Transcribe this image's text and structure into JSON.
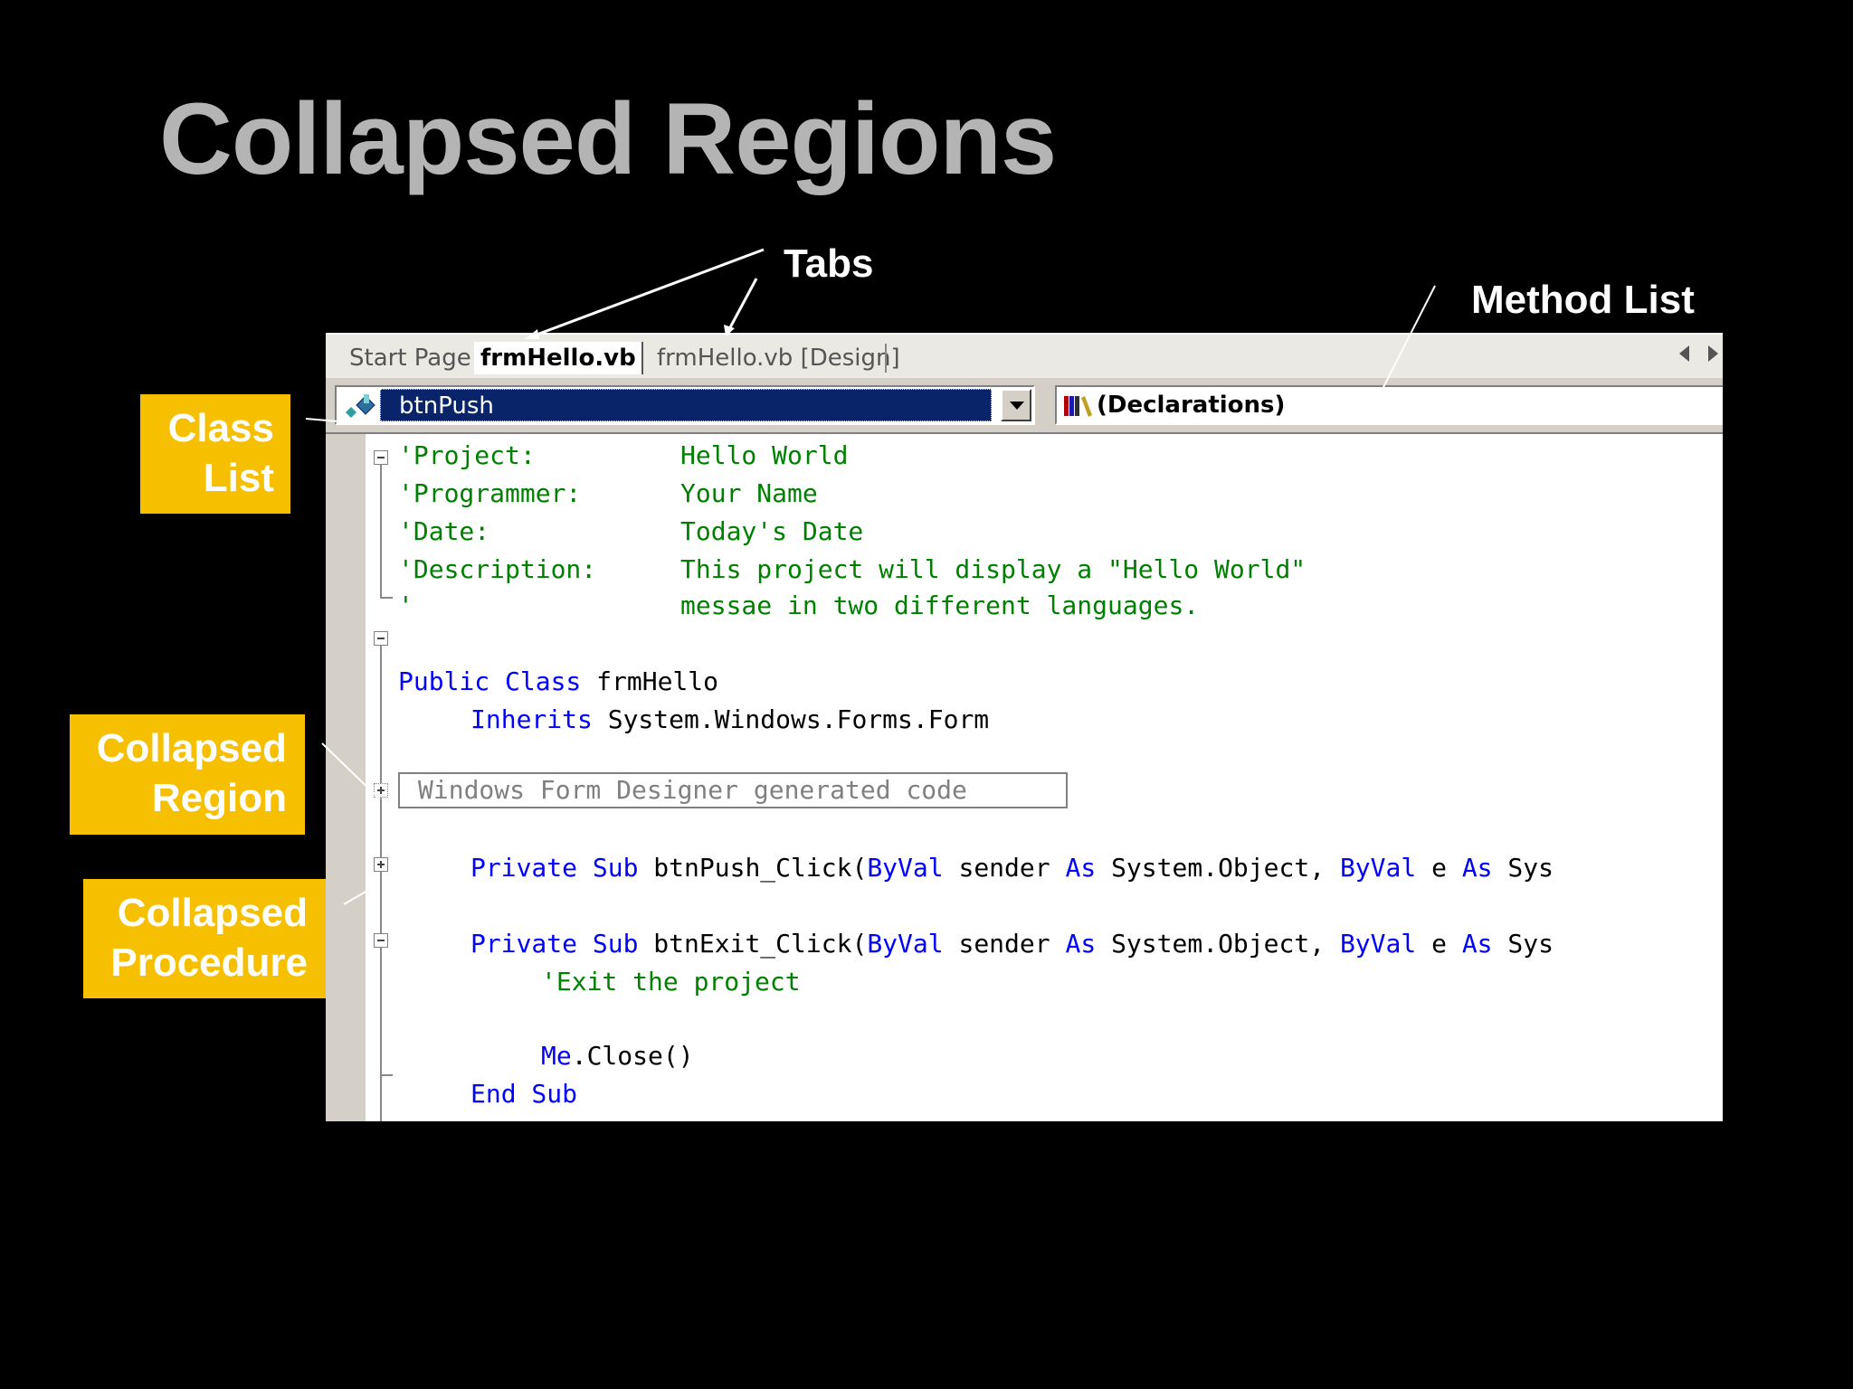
{
  "slide": {
    "title": "Collapsed Regions"
  },
  "callouts": {
    "tabs": "Tabs",
    "method_list": "Method List",
    "class_list": [
      "Class",
      "List"
    ],
    "collapsed_region": [
      "Collapsed",
      "Region"
    ],
    "collapsed_procedure": [
      "Collapsed",
      "Procedure"
    ]
  },
  "colors": {
    "callout_bg": "#f6c000",
    "title": "#b4b4b4",
    "keyword": "#0000ff",
    "comment": "#008000",
    "selection": "#0a246a"
  },
  "tabs": [
    {
      "label": "Start Page",
      "active": false
    },
    {
      "label": "frmHello.vb",
      "active": true
    },
    {
      "label": "frmHello.vb [Design]",
      "active": false
    }
  ],
  "class_list": {
    "selected": "btnPush",
    "icon": "class-member-icon"
  },
  "method_list": {
    "selected": "(Declarations)",
    "icon": "books-icon"
  },
  "code": {
    "header_comments": [
      {
        "label": "'Project:",
        "value": "Hello World"
      },
      {
        "label": "'Programmer:",
        "value": "Your Name"
      },
      {
        "label": "'Date:",
        "value": "Today's Date"
      },
      {
        "label": "'Description:",
        "value": "This project will display a \"Hello World\""
      },
      {
        "label": "'",
        "value": "messae in two different languages."
      }
    ],
    "class_decl": {
      "kw": "Public Class",
      "name": "frmHello"
    },
    "inherits": {
      "kw": "Inherits",
      "name": "System.Windows.Forms.Form"
    },
    "region_label": "Windows Form Designer generated code",
    "btn_push": {
      "kw1": "Private Sub",
      "name": "btnPush_Click(",
      "kw2": "ByVal",
      "t1": "sender",
      "kw3": "As",
      "t2": "System.Object,",
      "kw4": "ByVal",
      "t3": "e",
      "kw5": "As",
      "t4": "Sys"
    },
    "btn_exit": {
      "kw1": "Private Sub",
      "name": "btnExit_Click(",
      "kw2": "ByVal",
      "t1": "sender",
      "kw3": "As",
      "t2": "System.Object,",
      "kw4": "ByVal",
      "t3": "e",
      "kw5": "As",
      "t4": "Sys"
    },
    "exit_comment": "'Exit the project",
    "me_close": {
      "kw": "Me",
      "rest": ".Close()"
    },
    "end_sub": "End Sub"
  }
}
